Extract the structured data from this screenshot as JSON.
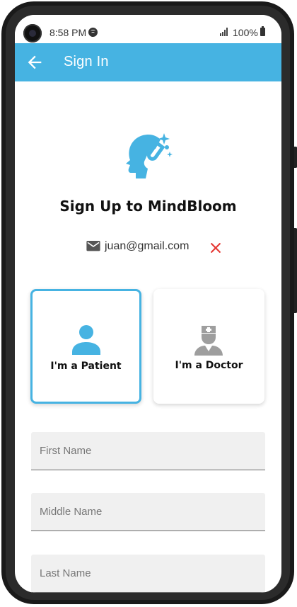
{
  "status_bar": {
    "time": "8:58 PM",
    "battery": "100%",
    "icons": [
      "camera-icon",
      "spotify-icon",
      "signal-icon",
      "battery-icon"
    ]
  },
  "app_bar": {
    "title": "Sign In",
    "back_icon": "arrow-left-icon",
    "color": "#46b3e2"
  },
  "main": {
    "logo_icon": "brain-magnet-icon",
    "title": "Sign Up to MindBloom",
    "email": "juan@gmail.com",
    "email_icon": "mail-icon",
    "clear_icon": "close-icon",
    "clear_color": "#e53935"
  },
  "roles": [
    {
      "label": "I'm a Patient",
      "icon": "person-icon",
      "selected": true,
      "icon_color": "#46b3e2"
    },
    {
      "label": "I'm a Doctor",
      "icon": "doctor-icon",
      "selected": false,
      "icon_color": "#9e9e9e"
    }
  ],
  "form": {
    "fields": [
      {
        "placeholder": "First Name",
        "value": ""
      },
      {
        "placeholder": "Middle Name",
        "value": ""
      },
      {
        "placeholder": "Last Name",
        "value": ""
      }
    ]
  }
}
